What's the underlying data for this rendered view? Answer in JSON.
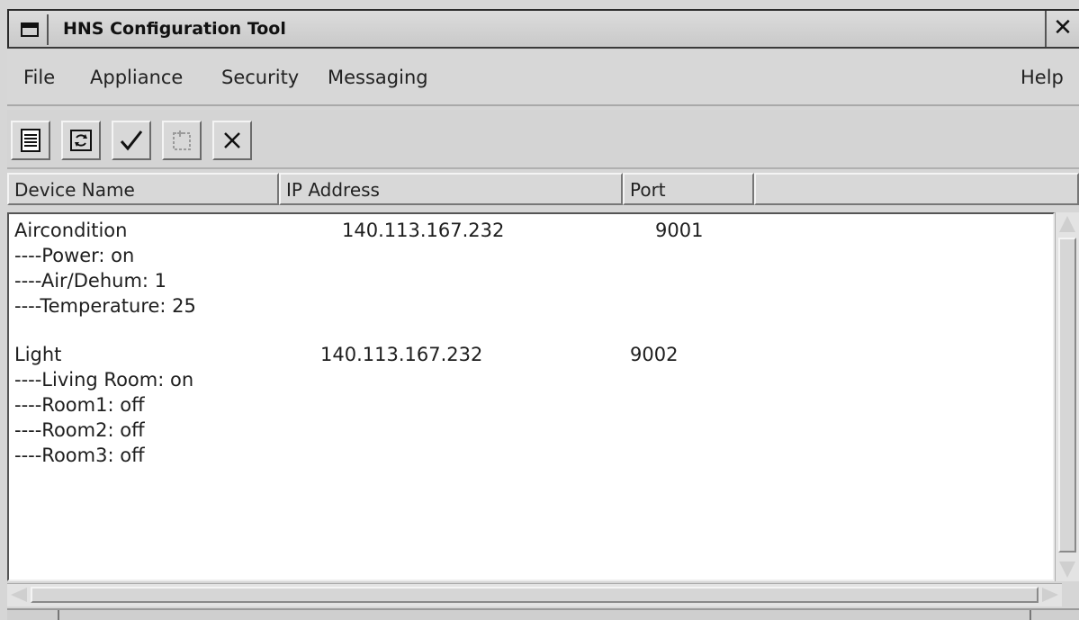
{
  "window": {
    "title": "HNS Configuration Tool",
    "close_symbol": "✕"
  },
  "menu": {
    "left": [
      "File",
      "Appliance",
      "Security",
      "Messaging"
    ],
    "help": "Help"
  },
  "toolbar": {
    "buttons": [
      {
        "name": "document-icon",
        "enabled": true
      },
      {
        "name": "refresh-icon",
        "enabled": true
      },
      {
        "name": "checkmark-icon",
        "enabled": true
      },
      {
        "name": "edit-icon",
        "enabled": false
      },
      {
        "name": "delete-x-icon",
        "enabled": true
      }
    ]
  },
  "columns": {
    "device_name": "Device Name",
    "ip_address": "IP Address",
    "port": "Port"
  },
  "devices": [
    {
      "name": "Aircondition",
      "ip": "140.113.167.232",
      "port": "9001",
      "properties": [
        "----Power: on",
        "----Air/Dehum: 1",
        "----Temperature: 25"
      ]
    },
    {
      "name": "Light",
      "ip": "140.113.167.232",
      "port": "9002",
      "properties": [
        "----Living Room: on",
        "----Room1: off",
        "----Room2: off",
        "----Room3: off"
      ]
    }
  ],
  "colors": {
    "window_bg": "#d6d6d6",
    "list_bg": "#ffffff",
    "text": "#1e1e1e"
  }
}
